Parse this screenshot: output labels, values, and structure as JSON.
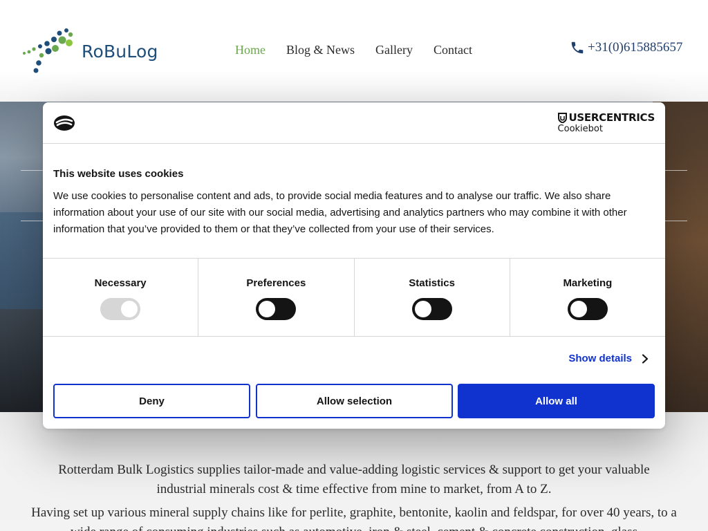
{
  "site": {
    "logo_text": "RoBuLog",
    "nav": [
      {
        "label": "Home",
        "active": true
      },
      {
        "label": "Blog & News",
        "active": false
      },
      {
        "label": "Gallery",
        "active": false
      },
      {
        "label": "Contact",
        "active": false
      }
    ],
    "phone": "+31(0)615885657",
    "accent_green": "#6aa84f",
    "brand_blue": "#1f4e79"
  },
  "content": {
    "paragraph1": "Rotterdam Bulk Logistics supplies tailor-made and value-adding logistic services & support to get your valuable industrial minerals cost & time effective from mine to market, from A to Z.",
    "paragraph2": "Having set up various mineral supply chains like for perlite, graphite, bentonite, kaolin and feldspar, for over 40 years, to a wide range of consuming industries such as automotive, iron & steel, cement & concrete construction, glass"
  },
  "cookie_dialog": {
    "provider_name": "USERCENTRICS",
    "provider_sub": "Cookiebot",
    "title": "This website uses cookies",
    "body": "We use cookies to personalise content and ads, to provide social media features and to analyse our traffic. We also share information about your use of our site with our social media, advertising and analytics partners who may combine it with other information that you’ve provided to them or that they’ve collected from your use of their services.",
    "categories": [
      {
        "label": "Necessary",
        "enabled": true,
        "locked": true
      },
      {
        "label": "Preferences",
        "enabled": false,
        "locked": false
      },
      {
        "label": "Statistics",
        "enabled": false,
        "locked": false
      },
      {
        "label": "Marketing",
        "enabled": false,
        "locked": false
      }
    ],
    "show_details_label": "Show details",
    "buttons": {
      "deny": "Deny",
      "allow_selection": "Allow selection",
      "allow_all": "Allow all"
    },
    "primary_color": "#1032cf"
  }
}
